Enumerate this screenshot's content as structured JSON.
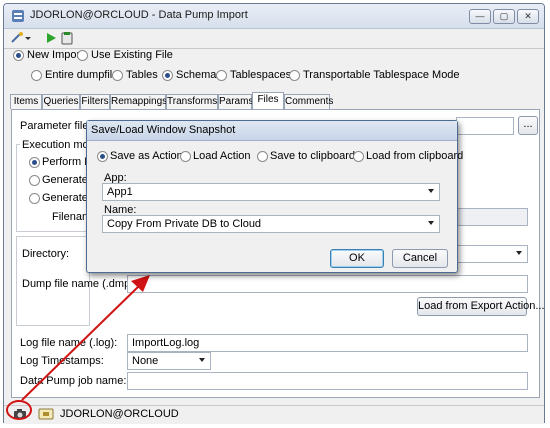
{
  "window": {
    "title": "JDORLON@ORCLOUD - Data Pump Import",
    "controls": [
      "—",
      "▢",
      "✕"
    ]
  },
  "import_mode": {
    "new_import": "New Import",
    "use_existing": "Use Existing File",
    "selected": "new_import"
  },
  "scope": {
    "options": [
      "Entire dumpfile",
      "Tables",
      "Schemas",
      "Tablespaces",
      "Transportable Tablespace Mode"
    ],
    "selected": "Schemas"
  },
  "tabs": [
    "Items",
    "Queries",
    "Filters",
    "Remappings",
    "Transforms",
    "Params",
    "Files",
    "Comments"
  ],
  "active_tab": "Files",
  "files_panel": {
    "param_file_label": "Parameter file name",
    "browse": "...",
    "execution_mode": "Execution mode",
    "exec_options": [
      "Perform Imp",
      "Generate Pa",
      "Generate SQ"
    ],
    "filename_label": "Filename",
    "directory_label": "Directory:",
    "dump_file_label": "Dump file name (.dmp):",
    "load_export_btn": "Load from Export Action...",
    "log_file_label": "Log file name (.log):",
    "log_file_value": "ImportLog.log",
    "log_timestamps_label": "Log Timestamps:",
    "log_timestamps_value": "None",
    "job_name_label": "Data Pump job name:"
  },
  "status": {
    "connection": "JDORLON@ORCLOUD"
  },
  "dialog": {
    "title": "Save/Load Window Snapshot",
    "options": [
      "Save as Action",
      "Load Action",
      "Save to clipboard",
      "Load from clipboard"
    ],
    "selected": "Save as Action",
    "app_label": "App:",
    "app_value": "App1",
    "name_label": "Name:",
    "name_value": "Copy From Private DB to Cloud",
    "ok": "OK",
    "cancel": "Cancel"
  },
  "colors": {
    "annotation": "#d21313",
    "accent": "#2c4f8a"
  }
}
